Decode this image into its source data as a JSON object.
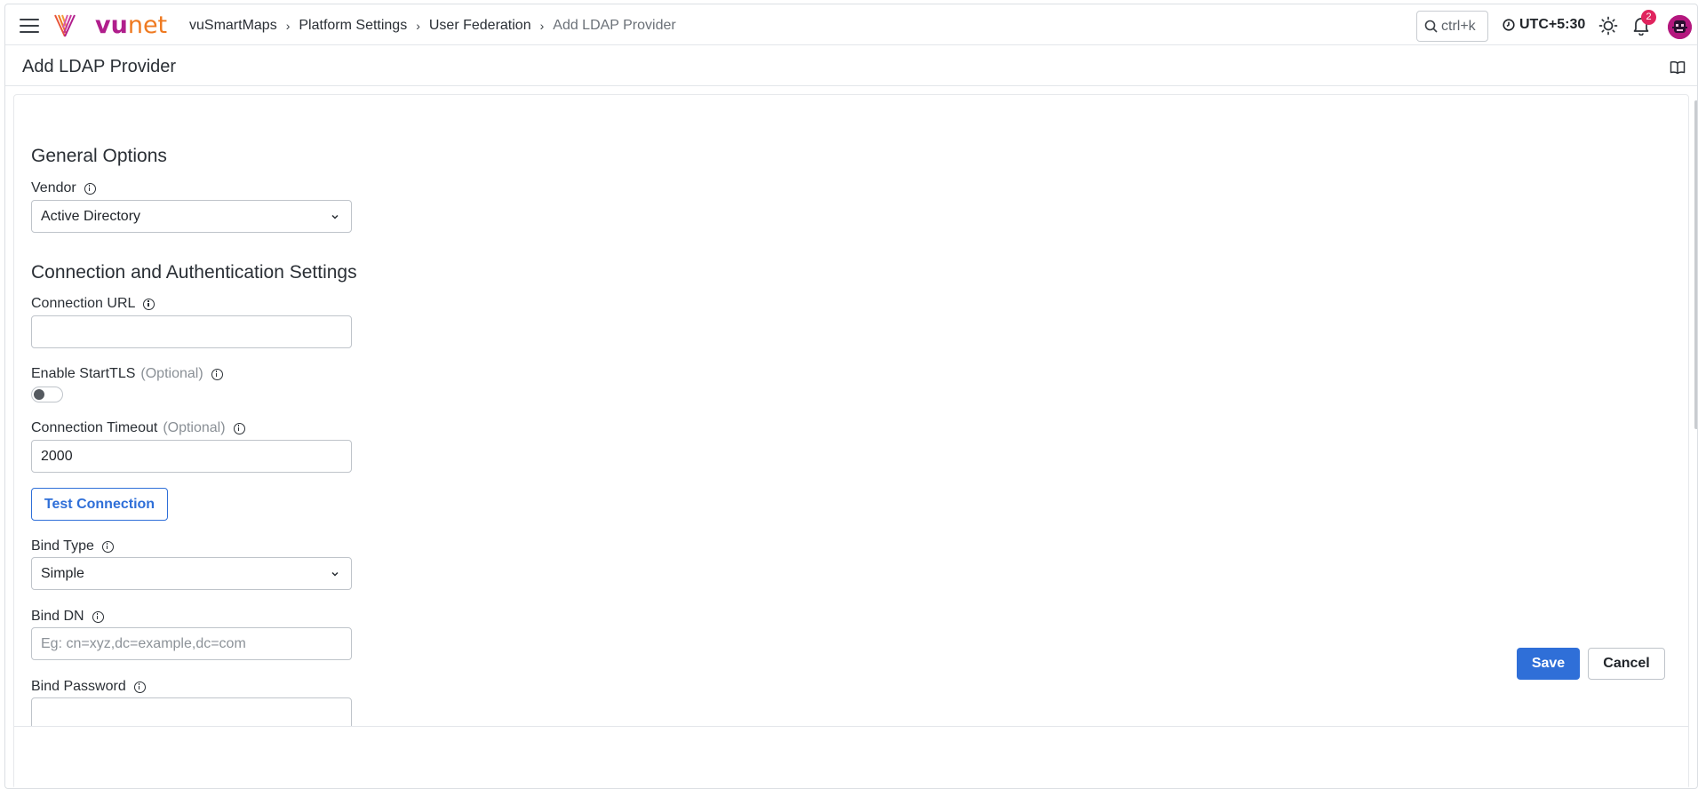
{
  "header": {
    "breadcrumb": [
      "vuSmartMaps",
      "Platform Settings",
      "User Federation"
    ],
    "breadcrumb_current": "Add LDAP Provider",
    "search_shortcut": "ctrl+k",
    "timezone": "UTC+5:30",
    "notification_count": "2",
    "logo": {
      "part1": "vu",
      "part2": "net"
    }
  },
  "page": {
    "title": "Add LDAP Provider"
  },
  "form": {
    "general_title": "General Options",
    "vendor_label": "Vendor",
    "vendor_value": "Active Directory",
    "connection_title": "Connection and Authentication Settings",
    "connection_url_label": "Connection URL",
    "connection_url_value": "",
    "starttls_label": "Enable StartTLS",
    "optional_text": "(Optional)",
    "starttls_enabled": false,
    "timeout_label": "Connection Timeout",
    "timeout_value": "2000",
    "test_connection_label": "Test Connection",
    "bind_type_label": "Bind Type",
    "bind_type_value": "Simple",
    "bind_dn_label": "Bind DN",
    "bind_dn_placeholder": "Eg: cn=xyz,dc=example,dc=com",
    "bind_password_label": "Bind Password"
  },
  "footer": {
    "save_label": "Save",
    "cancel_label": "Cancel"
  },
  "colors": {
    "primary": "#2f6fd8",
    "brand_magenta": "#b01e8c",
    "brand_orange": "#ef7a21",
    "badge": "#e0245e"
  }
}
